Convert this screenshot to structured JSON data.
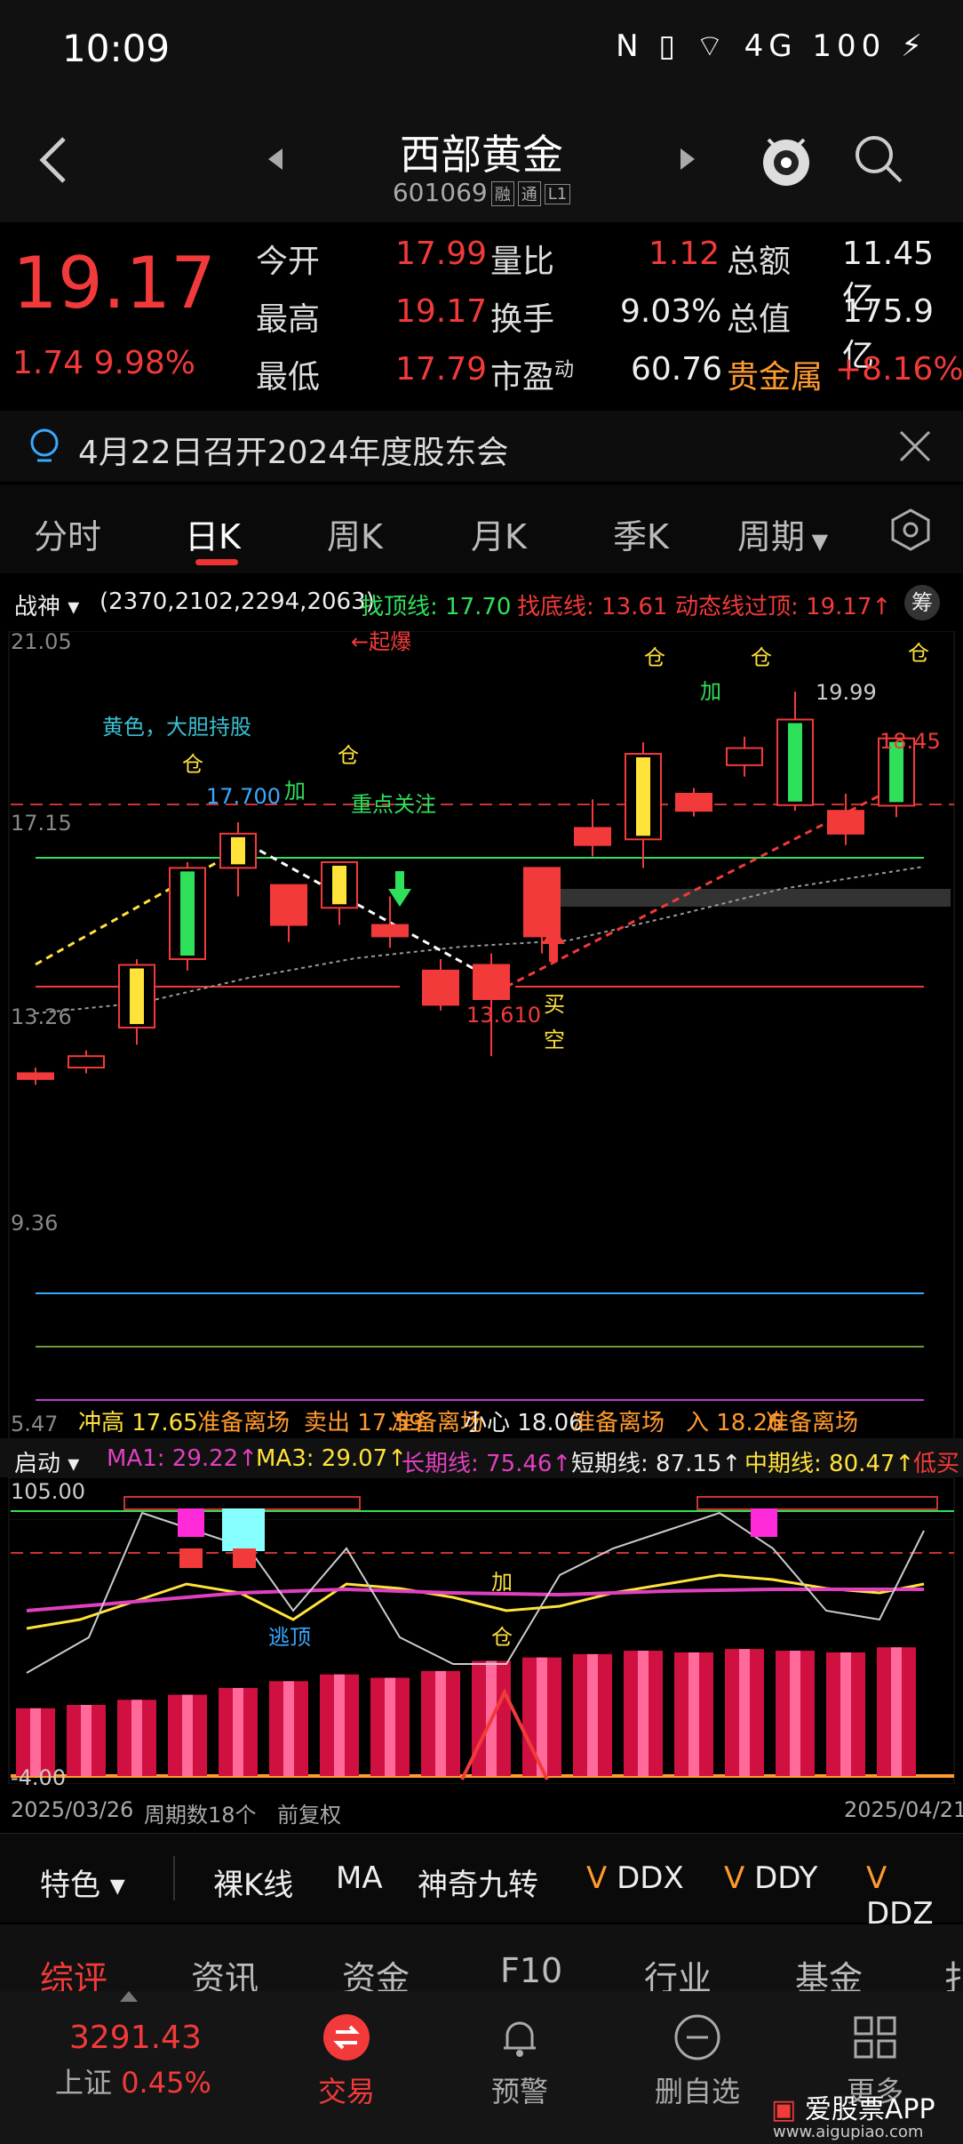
{
  "status": {
    "time": "10:09",
    "icons_text": "N ▯ ⌔ 4G 100 ⚡"
  },
  "header": {
    "title": "西部黄金",
    "code": "601069",
    "badge1": "融",
    "badge2": "通",
    "badge3": "L1"
  },
  "quote": {
    "price": "19.17",
    "change": "1.74",
    "pct": "9.98%",
    "rows": [
      {
        "l1": "今开",
        "v1": "17.99",
        "l2": "量比",
        "v2": "1.12",
        "l3": "总额",
        "v3": "11.45亿"
      },
      {
        "l1": "最高",
        "v1": "19.17",
        "l2": "换手",
        "v2": "9.03%",
        "l3": "总值",
        "v3": "175.9亿"
      },
      {
        "l1": "最低",
        "v1": "17.79",
        "l2": "市盈",
        "l2sup": "动",
        "v2": "60.76",
        "l3": "贵金属",
        "v3": "+8.16%"
      }
    ]
  },
  "notice": {
    "text": "4月22日召开2024年度股东会"
  },
  "tabs": [
    "分时",
    "日K",
    "周K",
    "月K",
    "季K",
    "周期"
  ],
  "indicator": {
    "name": "战神",
    "params": "(2370,2102,2294,2063)",
    "top_line": "找顶线: 17.70",
    "bottom_line": "找底线: 13.61",
    "dyn_line": "动态线过顶: 19.17↑",
    "more": "筹"
  },
  "chart_labels": {
    "y_top": "21.05",
    "y_mid": "17.15",
    "y_low": "13.26",
    "y_lower": "9.36",
    "y_bottom": "5.47",
    "qibao": "←起爆",
    "yellow_hold": "黄色，大胆持股",
    "cang": "仓",
    "jia": "加",
    "focus": "重点关注",
    "high1": "17.700",
    "low1": "13.610",
    "high2": "19.99",
    "r1": "18.45",
    "buy": "买",
    "empty": "空",
    "legend": [
      "冲高 17.65",
      "准备离场",
      "卖出 17.59",
      "准备离场",
      "小心 18.06",
      "准备离场",
      "入 18.26",
      "准备离场"
    ]
  },
  "sub_indicator": {
    "name": "启动",
    "ma1": "MA1: 29.22↑",
    "ma3": "MA3: 29.07↑",
    "long": "长期线: 75.46↑",
    "short": "短期线: 87.15↑",
    "mid": "中期线: 80.47↑",
    "buy": "低买",
    "y_top": "105.00",
    "y_bottom": "-4.00",
    "escape": "逃顶",
    "jia": "加",
    "cang": "仓"
  },
  "dates": {
    "start": "2025/03/26",
    "weeks": "周期数18个",
    "adj": "前复权",
    "end": "2025/04/21"
  },
  "features": [
    "特色",
    "裸K线",
    "MA",
    "神奇九转",
    "DDX",
    "DDY",
    "DDZ"
  ],
  "bottom_tabs": [
    "综评",
    "资讯",
    "资金",
    "F10",
    "行业",
    "基金",
    "扌"
  ],
  "nav": {
    "index_value": "3291.43",
    "index_name": "上证",
    "index_pct": "0.45%",
    "trade": "交易",
    "alert": "预警",
    "remove": "删自选",
    "more": "更多",
    "app": "爱股票APP",
    "site": "www.aigupiao.com"
  },
  "colors": {
    "up": "#f23a3a",
    "down": "#2fe05a",
    "accent": "#e33"
  },
  "chart_data": {
    "type": "candlestick",
    "candles": [
      {
        "o": 13.3,
        "c": 13.2,
        "h": 13.4,
        "l": 13.1
      },
      {
        "o": 13.4,
        "c": 13.6,
        "h": 13.7,
        "l": 13.3
      },
      {
        "o": 14.1,
        "c": 15.2,
        "h": 15.3,
        "l": 13.8
      },
      {
        "o": 15.3,
        "c": 16.9,
        "h": 17.0,
        "l": 15.1
      },
      {
        "o": 16.9,
        "c": 17.5,
        "h": 17.7,
        "l": 16.4
      },
      {
        "o": 16.6,
        "c": 15.9,
        "h": 16.6,
        "l": 15.6
      },
      {
        "o": 16.2,
        "c": 17.0,
        "h": 17.0,
        "l": 15.9
      },
      {
        "o": 15.9,
        "c": 15.7,
        "h": 16.4,
        "l": 15.5
      },
      {
        "o": 15.1,
        "c": 14.5,
        "h": 15.3,
        "l": 14.4
      },
      {
        "o": 15.2,
        "c": 14.6,
        "h": 15.4,
        "l": 13.6
      },
      {
        "o": 16.9,
        "c": 15.7,
        "h": 16.9,
        "l": 15.4
      },
      {
        "o": 17.6,
        "c": 17.3,
        "h": 18.1,
        "l": 17.1
      },
      {
        "o": 17.4,
        "c": 18.9,
        "h": 19.1,
        "l": 16.9
      },
      {
        "o": 18.2,
        "c": 17.9,
        "h": 18.3,
        "l": 17.8
      },
      {
        "o": 18.7,
        "c": 19.0,
        "h": 19.2,
        "l": 18.5
      },
      {
        "o": 18.0,
        "c": 19.5,
        "h": 19.99,
        "l": 17.9
      },
      {
        "o": 17.9,
        "c": 17.5,
        "h": 18.2,
        "l": 17.3
      },
      {
        "o": 17.99,
        "c": 19.17,
        "h": 19.17,
        "l": 17.79
      }
    ],
    "ylim": [
      5.47,
      21.05
    ],
    "volume": [
      40,
      42,
      45,
      48,
      52,
      56,
      60,
      58,
      62,
      68,
      70,
      72,
      74,
      73,
      75,
      74,
      73,
      76
    ]
  }
}
